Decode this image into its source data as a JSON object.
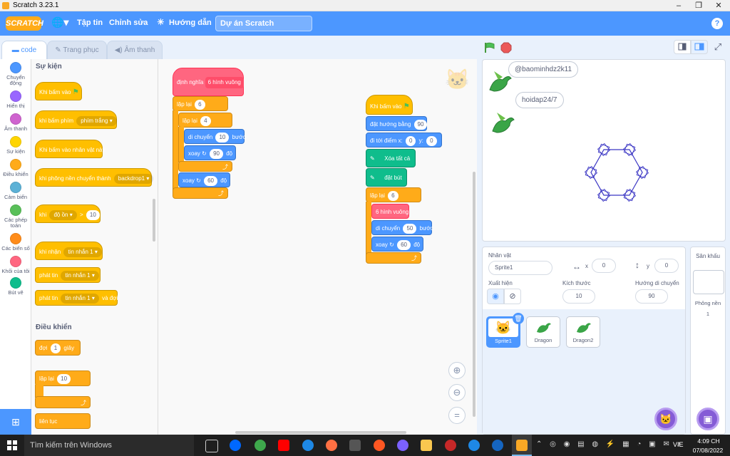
{
  "window": {
    "title": "Scratch 3.23.1",
    "min": "–",
    "max": "❐",
    "close": "✕"
  },
  "menu": {
    "logo": "SCRATCH",
    "file": "Tập tin",
    "edit": "Chỉnh sửa",
    "tutorials": "Hướng dẫn",
    "project_title": "Dự án Scratch",
    "help": "?"
  },
  "tabs": {
    "code": "code",
    "costumes": "Trang phục",
    "sounds": "Âm thanh"
  },
  "categories": [
    {
      "label": "Chuyển động",
      "color": "#4c97ff"
    },
    {
      "label": "Hiển thị",
      "color": "#9966ff"
    },
    {
      "label": "Âm thanh",
      "color": "#cf63cf"
    },
    {
      "label": "Sự kiện",
      "color": "#ffd500"
    },
    {
      "label": "Điều khiển",
      "color": "#ffab19"
    },
    {
      "label": "Cảm biến",
      "color": "#5cb1d6"
    },
    {
      "label": "Các phép toán",
      "color": "#59c059"
    },
    {
      "label": "Các biến số",
      "color": "#ff8c1a"
    },
    {
      "label": "Khối của tôi",
      "color": "#ff6680"
    },
    {
      "label": "Bút vẽ",
      "color": "#0fbd8c"
    }
  ],
  "palette": {
    "events_head": "Sự kiện",
    "when_flag": "Khi bấm vào",
    "when_key": "khi bấm phím",
    "key_value": "phím trắng",
    "when_sprite": "Khi bấm vào nhân vật này",
    "when_backdrop": "khi phông nền chuyển thành",
    "backdrop_value": "backdrop1",
    "when_prefix": "khi",
    "loudness": "độ ồn",
    "gt": ">",
    "loud_value": "10",
    "when_receive": "khi nhận",
    "msg1": "tin nhắn 1",
    "broadcast": "phát tin",
    "msg2": "tin nhắn 1",
    "broadcast_wait": "phát tin",
    "msg3": "tin nhắn 1",
    "and_wait": "và đợi",
    "control_head": "Điều khiển",
    "wait": "đợi",
    "wait_value": "1",
    "seconds": "giây",
    "repeat": "lặp lại",
    "repeat_value": "10",
    "forever": "liên tục"
  },
  "script1": {
    "define": "định nghĩa",
    "define_name": "6 hình vuông",
    "repeat1": "lặp lại",
    "repeat1_val": "6",
    "repeat2": "lặp lại",
    "repeat2_val": "4",
    "move": "di chuyển",
    "move_val": "10",
    "steps": "bước",
    "turn1": "xoay",
    "turn1_val": "90",
    "deg1": "độ",
    "turn2": "xoay",
    "turn2_val": "60",
    "deg2": "độ"
  },
  "script2": {
    "when_flag": "Khi bấm vào",
    "point": "đặt hướng bằng",
    "point_val": "90",
    "goto": "đi tới điểm x:",
    "goto_x": "0",
    "goto_y_label": "y:",
    "goto_y": "0",
    "clear": "Xóa tất cả",
    "pendown": "đặt bút",
    "repeat": "lặp lại",
    "repeat_val": "6",
    "call": "6 hình vuông",
    "move": "di chuyển",
    "move_val": "50",
    "steps": "bước",
    "turn": "xoay",
    "turn_val": "60",
    "deg": "độ"
  },
  "stage": {
    "bubble1": "@baominhdz2k11",
    "bubble2": "hoidap24/7"
  },
  "sprite_info": {
    "sprite_label": "Nhân vật",
    "sprite_name": "Sprite1",
    "x_label": "x",
    "x_val": "0",
    "y_label": "y",
    "y_val": "0",
    "show_label": "Xuất hiện",
    "size_label": "Kích thước",
    "size_val": "10",
    "dir_label": "Hướng di chuyển",
    "dir_val": "90"
  },
  "sprites": [
    {
      "name": "Sprite1",
      "selected": true
    },
    {
      "name": "Dragon",
      "selected": false
    },
    {
      "name": "Dragon2",
      "selected": false
    }
  ],
  "backdrop": {
    "title": "Sân khấu",
    "label": "Phông nền",
    "count": "1"
  },
  "taskbar": {
    "search": "Tìm kiếm trên Windows",
    "time": "4:09 CH",
    "date": "07/08/2022",
    "lang": "VIE"
  }
}
